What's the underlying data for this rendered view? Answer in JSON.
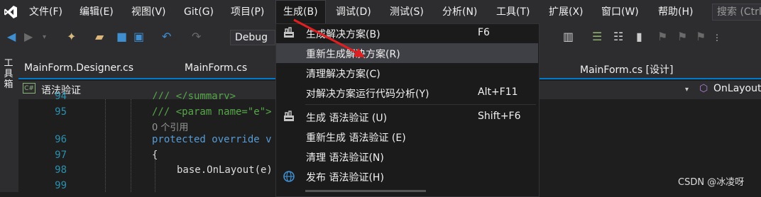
{
  "menubar": {
    "items": [
      "文件(F)",
      "编辑(E)",
      "视图(V)",
      "Git(G)",
      "项目(P)",
      "生成(B)",
      "调试(D)",
      "测试(S)",
      "分析(N)",
      "工具(T)",
      "扩展(X)",
      "窗口(W)",
      "帮助(H)"
    ],
    "search_placeholder": "搜索 (Ctrl"
  },
  "toolbar": {
    "config": "Debug"
  },
  "left_toolbox": {
    "label": "工具箱"
  },
  "tabs": [
    "MainForm.Designer.cs",
    "MainForm.cs",
    "MainForm.cs [设计]"
  ],
  "navbar": {
    "cs_badge": "C#",
    "project": "语法验证",
    "member": "OnLayout"
  },
  "editor": {
    "line_numbers": [
      "94",
      "95",
      "",
      "96",
      "97",
      "98",
      "99"
    ],
    "lines": [
      "/// </summary>",
      "/// <param name=\"e\">",
      "0 个引用",
      "protected override v",
      "{",
      "base.OnLayout(e)",
      ""
    ]
  },
  "build_menu": {
    "items": [
      {
        "label": "生成解决方案(B)",
        "shortcut": "F6"
      },
      {
        "label": "重新生成解决方案(R)",
        "shortcut": ""
      },
      {
        "label": "清理解决方案(C)",
        "shortcut": ""
      },
      {
        "label": "对解决方案运行代码分析(Y)",
        "shortcut": "Alt+F11"
      },
      {
        "label": "生成 语法验证 (U)",
        "shortcut": "Shift+F6"
      },
      {
        "label": "重新生成 语法验证 (E)",
        "shortcut": ""
      },
      {
        "label": "清理 语法验证(N)",
        "shortcut": ""
      },
      {
        "label": "发布 语法验证(H)",
        "shortcut": ""
      }
    ]
  },
  "watermark": "CSDN @冰凌呀",
  "colors": {
    "accent": "#007acc",
    "arrow": "#e02020",
    "keyword": "#569cd6",
    "comment": "#57a64a"
  }
}
